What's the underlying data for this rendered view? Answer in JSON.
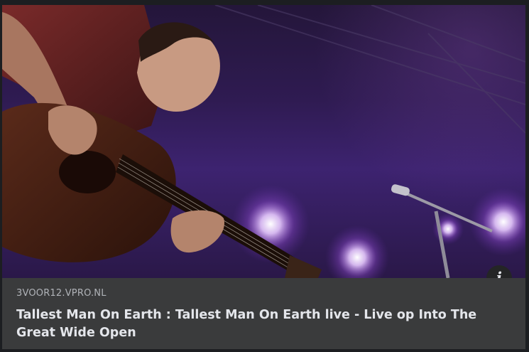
{
  "link_preview": {
    "image_alt": "Musician playing acoustic guitar on stage under purple lights",
    "info_icon": "info-icon",
    "info_glyph": "i",
    "source_domain": "3VOOR12.VPRO.NL",
    "title": "Tallest Man On Earth : Tallest Man On Earth live - Live op Into The Great Wide Open"
  },
  "colors": {
    "card_bg": "#3a3b3c",
    "page_bg": "#1c1e21",
    "source_text": "#b0b3b8",
    "title_text": "#e4e6eb",
    "stage_light": "#b46cff"
  }
}
